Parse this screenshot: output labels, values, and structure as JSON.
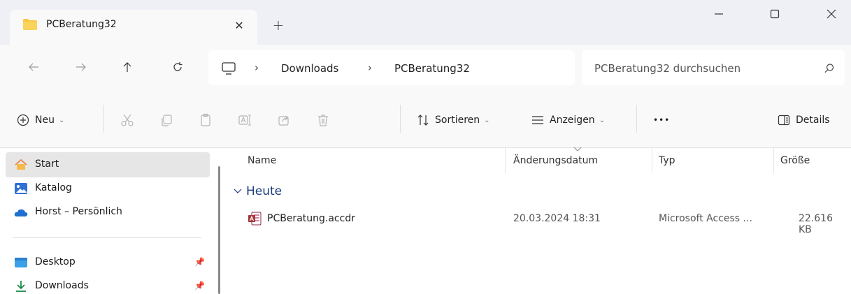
{
  "window": {
    "tab_title": "PCBeratung32",
    "new_tab": "+",
    "close_tab": "✕"
  },
  "address": {
    "breadcrumbs": [
      "Downloads",
      "PCBeratung32"
    ],
    "separator": "›",
    "search_placeholder": "PCBeratung32 durchsuchen"
  },
  "toolbar": {
    "new_label": "Neu",
    "sort_label": "Sortieren",
    "view_label": "Anzeigen",
    "more_label": "•••",
    "details_label": "Details"
  },
  "sidebar": {
    "items": [
      {
        "label": "Start",
        "icon": "home-icon"
      },
      {
        "label": "Katalog",
        "icon": "gallery-icon"
      },
      {
        "label": "Horst – Persönlich",
        "icon": "onedrive-icon"
      },
      {
        "label": "Desktop",
        "icon": "desktop-icon"
      },
      {
        "label": "Downloads",
        "icon": "download-icon"
      }
    ]
  },
  "columns": {
    "name": "Name",
    "date": "Änderungsdatum",
    "type": "Typ",
    "size": "Größe"
  },
  "group": {
    "label": "Heute"
  },
  "files": [
    {
      "name": "PCBeratung.accdr",
      "date": "20.03.2024 18:31",
      "type": "Microsoft Access ...",
      "size": "22.616 KB"
    }
  ],
  "colors": {
    "accent": "#1a3d7c",
    "folder": "#f7c948",
    "selected": "#e6e6e6"
  }
}
